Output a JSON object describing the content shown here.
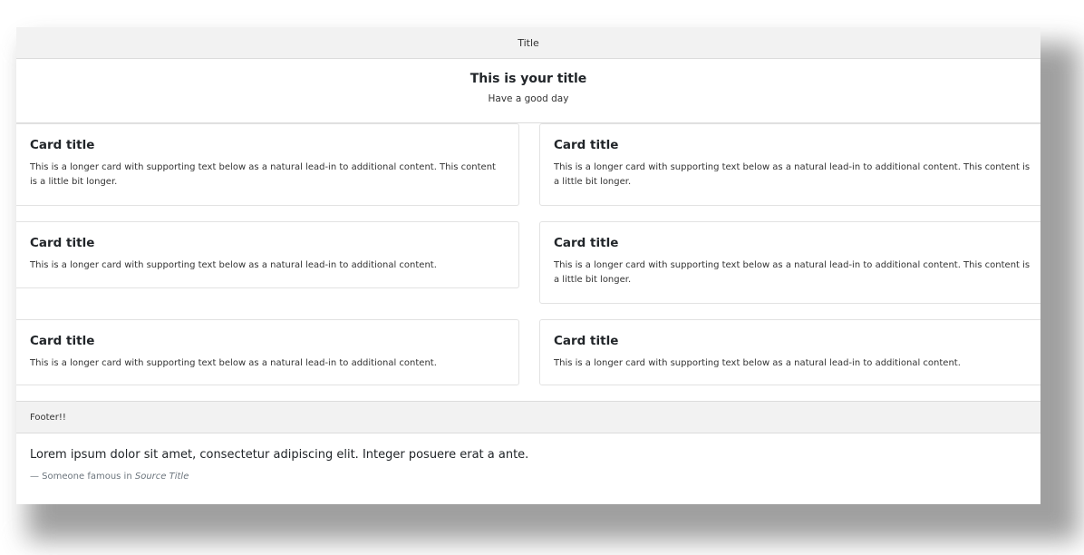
{
  "header": {
    "title": "Title"
  },
  "hero": {
    "title": "This is your title",
    "subtitle": "Have a good day"
  },
  "cards": [
    {
      "title": "Card title",
      "text": "This is a longer card with supporting text below as a natural lead-in to additional content. This content is a little bit longer."
    },
    {
      "title": "Card title",
      "text": "This is a longer card with supporting text below as a natural lead-in to additional content. This content is a little bit longer."
    },
    {
      "title": "Card title",
      "text": "This is a longer card with supporting text below as a natural lead-in to additional content."
    },
    {
      "title": "Card title",
      "text": "This is a longer card with supporting text below as a natural lead-in to additional content. This content is a little bit longer."
    },
    {
      "title": "Card title",
      "text": "This is a longer card with supporting text below as a natural lead-in to additional content."
    },
    {
      "title": "Card title",
      "text": "This is a longer card with supporting text below as a natural lead-in to additional content."
    }
  ],
  "footer": {
    "label": "Footer!!"
  },
  "quote": {
    "text": "Lorem ipsum dolor sit amet, consectetur adipiscing elit. Integer posuere erat a ante.",
    "attribution": "— Someone famous in",
    "source": "Source Title"
  }
}
